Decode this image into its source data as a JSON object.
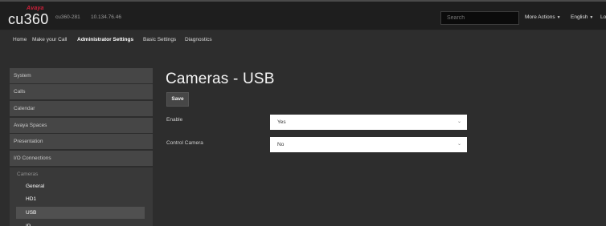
{
  "header": {
    "brand": "Avaya",
    "model": "cu360",
    "device_name": "cu360-281",
    "device_ip": "10.134.76.46",
    "search_placeholder": "Search",
    "more_actions": "More Actions",
    "language": "English",
    "truncated_menu": "Lo"
  },
  "nav": {
    "items": [
      "Home",
      "Make your Call",
      "Administrator Settings",
      "Basic Settings",
      "Diagnostics"
    ],
    "active": "Administrator Settings"
  },
  "sidebar": {
    "items": [
      "System",
      "Calls",
      "Calendar",
      "Avaya Spaces",
      "Presentation",
      "I/O Connections"
    ],
    "sub_title": "Cameras",
    "sub_items": [
      "General",
      "HD1",
      "USB",
      "IP"
    ],
    "selected": "USB"
  },
  "main": {
    "title": "Cameras - USB",
    "save_label": "Save",
    "fields": [
      {
        "label": "Enable",
        "value": "Yes"
      },
      {
        "label": "Control Camera",
        "value": "No"
      }
    ]
  },
  "colors": {
    "brand_red": "#d0203a",
    "page_background": "#2d2d2d",
    "header_background": "#1e1e1e"
  }
}
